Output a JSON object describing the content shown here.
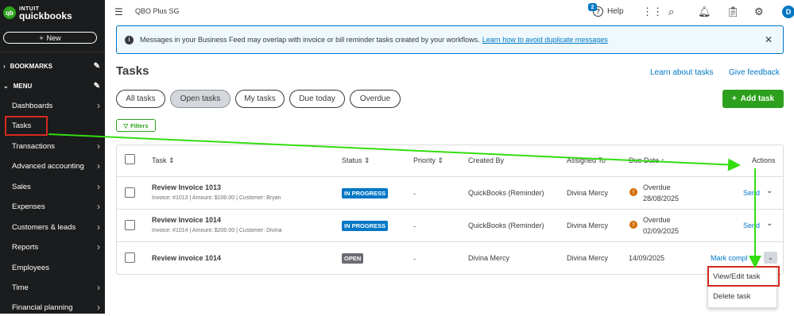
{
  "logo": {
    "badge": "qb",
    "line1": "INTUIT",
    "line2": "quickbooks"
  },
  "sidebar": {
    "new_label": "New",
    "bookmarks": "BOOKMARKS",
    "menu": "MENU",
    "items": [
      {
        "label": "Dashboards"
      },
      {
        "label": "Tasks"
      },
      {
        "label": "Transactions"
      },
      {
        "label": "Advanced accounting"
      },
      {
        "label": "Sales"
      },
      {
        "label": "Expenses"
      },
      {
        "label": "Customers & leads"
      },
      {
        "label": "Reports"
      },
      {
        "label": "Employees"
      },
      {
        "label": "Time"
      },
      {
        "label": "Financial planning"
      }
    ]
  },
  "topbar": {
    "company": "QBO Plus SG",
    "help": "Help",
    "notif_count": "2",
    "avatar": "D"
  },
  "banner": {
    "text": "Messages in your Business Feed may overlap with invoice or bill reminder tasks created by your workflows.",
    "link": "Learn how to avoid duplicate messages"
  },
  "page": {
    "title": "Tasks",
    "learn": "Learn about tasks",
    "feedback": "Give feedback"
  },
  "tabs": [
    {
      "label": "All tasks"
    },
    {
      "label": "Open tasks"
    },
    {
      "label": "My tasks"
    },
    {
      "label": "Due today"
    },
    {
      "label": "Overdue"
    }
  ],
  "add_task": "Add task",
  "filters": "Filters",
  "columns": {
    "task": "Task",
    "status": "Status",
    "priority": "Priority",
    "created_by": "Created By",
    "assigned_to": "Assigned To",
    "due_date": "Due Date",
    "actions": "Actions"
  },
  "rows": [
    {
      "name": "Review Invoice 1013",
      "sub": "Invoice: #1013 | Amount: $100.00 | Customer: Bryan",
      "status": "IN PROGRESS",
      "priority": "-",
      "created_by": "QuickBooks (Reminder)",
      "assigned_to": "Divina Mercy",
      "due_label": "Overdue",
      "due_date": "28/08/2025",
      "action": "Send"
    },
    {
      "name": "Review Invoice 1014",
      "sub": "Invoice: #1014 | Amount: $200.00 | Customer: Divina",
      "status": "IN PROGRESS",
      "priority": "-",
      "created_by": "QuickBooks (Reminder)",
      "assigned_to": "Divina Mercy",
      "due_label": "Overdue",
      "due_date": "02/09/2025",
      "action": "Send"
    },
    {
      "name": "Review invoice 1014",
      "sub": "",
      "status": "OPEN",
      "priority": "-",
      "created_by": "Divina Mercy",
      "assigned_to": "Divina Mercy",
      "due_label": "",
      "due_date": "14/09/2025",
      "action": "Mark compl"
    }
  ],
  "dropdown": {
    "items": [
      {
        "label": "View/Edit task"
      },
      {
        "label": "Delete task"
      }
    ]
  },
  "colors": {
    "green": "#2ca01c",
    "blue": "#0077c5",
    "red": "#d52b1e",
    "arrow": "#33dd11",
    "sidebar": "#1b1c1d"
  }
}
